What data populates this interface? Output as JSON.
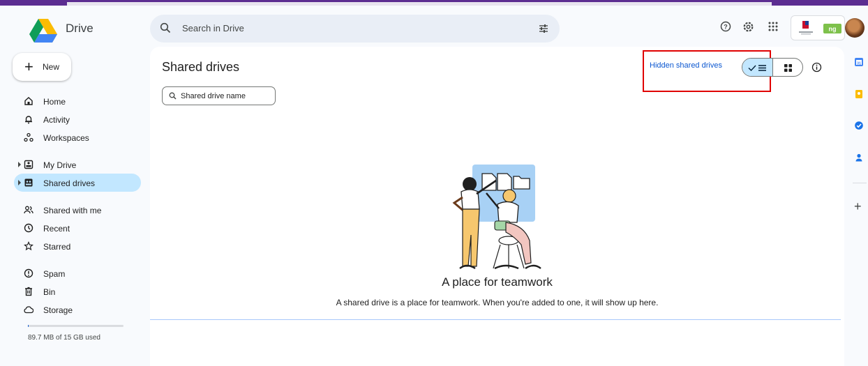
{
  "app": {
    "name": "Drive"
  },
  "search": {
    "placeholder": "Search in Drive"
  },
  "sidebar": {
    "new_label": "New",
    "items": [
      {
        "label": "Home",
        "icon": "home-icon"
      },
      {
        "label": "Activity",
        "icon": "bell-icon"
      },
      {
        "label": "Workspaces",
        "icon": "workspaces-icon"
      },
      {
        "label": "My Drive",
        "icon": "my-drive-icon"
      },
      {
        "label": "Shared drives",
        "icon": "shared-drives-icon",
        "active": true
      },
      {
        "label": "Shared with me",
        "icon": "people-icon"
      },
      {
        "label": "Recent",
        "icon": "clock-icon"
      },
      {
        "label": "Starred",
        "icon": "star-icon"
      },
      {
        "label": "Spam",
        "icon": "spam-icon"
      },
      {
        "label": "Bin",
        "icon": "trash-icon"
      },
      {
        "label": "Storage",
        "icon": "cloud-icon"
      }
    ],
    "storage_text": "89.7 MB of 15 GB used",
    "storage_fraction": 0.006
  },
  "main": {
    "title": "Shared drives",
    "filter_placeholder": "Shared drive name",
    "hidden_link": "Hidden shared drives",
    "empty_title": "A place for teamwork",
    "empty_desc": "A shared drive is a place for teamwork. When you're added to one, it will show up here."
  },
  "colors": {
    "accent": "#0b57d0",
    "active_bg": "#c2e7ff",
    "highlight_box": "#e00000"
  }
}
